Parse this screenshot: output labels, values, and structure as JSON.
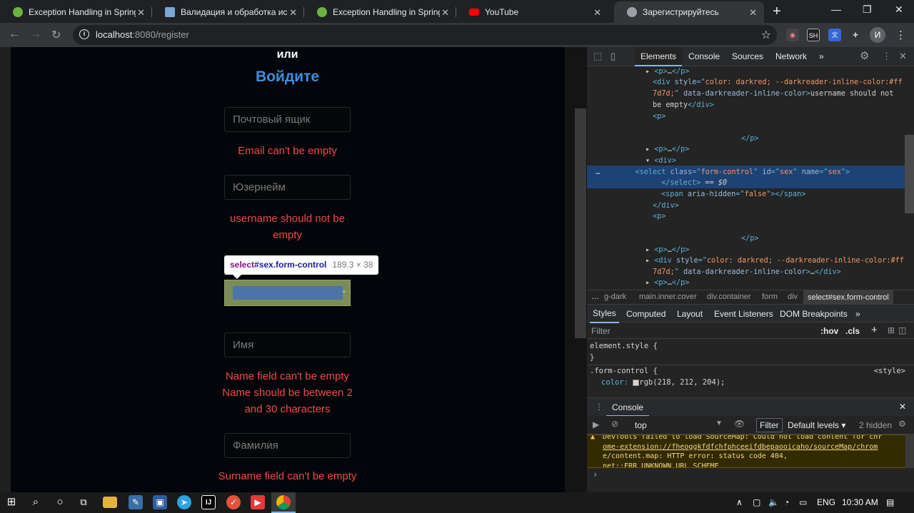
{
  "browser": {
    "tabs": [
      {
        "title": "Exception Handling in Spring M",
        "favicon": "spring-leaf-icon",
        "color": "#6db33f"
      },
      {
        "title": "Валидация и обработка исклю",
        "favicon": "habr-icon",
        "color": "#7aa7d6"
      },
      {
        "title": "Exception Handling in Spring M",
        "favicon": "spring-leaf-icon",
        "color": "#6db33f"
      },
      {
        "title": "YouTube",
        "favicon": "youtube-icon",
        "color": "#ff0000"
      },
      {
        "title": "Зарегистрируйтесь",
        "favicon": "globe-icon",
        "color": "#9aa0a6"
      }
    ],
    "url_host": "localhost",
    "url_path": ":8080/register",
    "avatar_initial": "И"
  },
  "page": {
    "or_label": "или",
    "login_link": "Войдите",
    "email_placeholder": "Почтовый ящик",
    "email_error": "Email can't be empty",
    "username_placeholder": "Юзернейм",
    "username_error": "username should not be empty",
    "tooltip_selector": "select",
    "tooltip_id_class": "#sex.form-control",
    "tooltip_size": "189.3 × 38",
    "name_placeholder": "Имя",
    "name_error_1": "Name field can't be empty",
    "name_error_2": "Name should be between 2 and 30 characters",
    "surname_placeholder": "Фамилия",
    "surname_error": "Surname field can't be empty"
  },
  "devtools": {
    "tabs": [
      "Elements",
      "Console",
      "Sources",
      "Network",
      "»"
    ],
    "breadcrumb": [
      "…",
      "g-dark",
      "main.inner.cover",
      "div.container",
      "form",
      "div",
      "select#sex.form-control"
    ],
    "style_tabs": [
      "Styles",
      "Computed",
      "Layout",
      "Event Listeners",
      "DOM Breakpoints",
      "»"
    ],
    "filter_placeholder": "Filter",
    "hov": ":hov",
    "cls": ".cls",
    "element_style": "element.style {",
    "close_brace": "}",
    "form_control_rule": ".form-control {",
    "style_source": "<style>",
    "color_prop": "color:",
    "color_val": "rgb(218, 212, 204);",
    "console_title": "Console",
    "console_context": "top",
    "console_filter": "Filter",
    "console_levels": "Default levels ▾",
    "console_hidden": "2 hidden",
    "warning_lines": [
      "DevTools failed to load SourceMap: Could not load content for chr",
      "ome-extension://fheoggkfdfchfphceeifdbepaooicaho/sourceMap/chrom",
      "e/content.map: HTTP error: status code 404,",
      "net::ERR_UNKNOWN_URL_SCHEME"
    ],
    "prompt": "›"
  },
  "taskbar": {
    "language": "ENG",
    "time": "10:30 AM"
  }
}
